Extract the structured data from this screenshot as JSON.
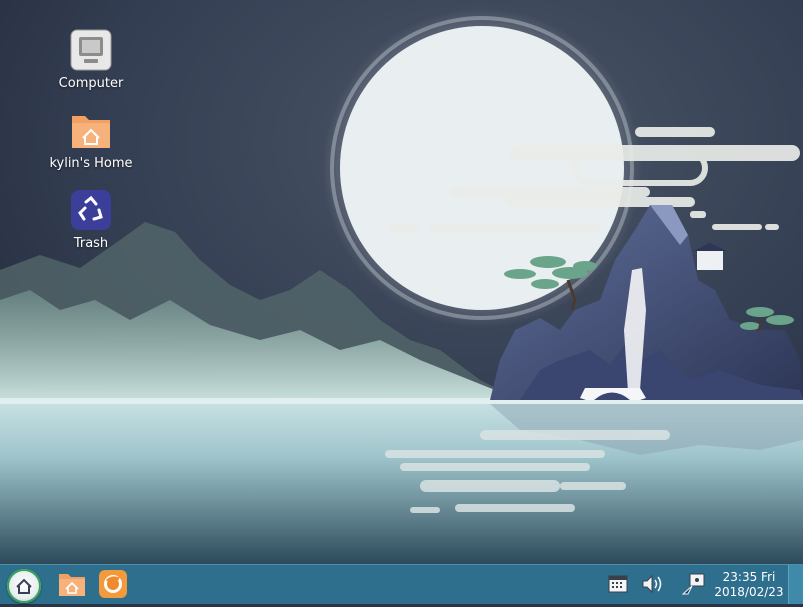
{
  "desktop": {
    "icons": [
      {
        "label": "Computer",
        "icon": "computer-icon"
      },
      {
        "label": "kylin's Home",
        "icon": "home-folder-icon"
      },
      {
        "label": "Trash",
        "icon": "trash-icon"
      }
    ]
  },
  "taskbar": {
    "start_menu_icon": "kylin-start-icon",
    "launchers": [
      {
        "icon": "file-manager-icon"
      },
      {
        "icon": "firefox-icon"
      }
    ],
    "tray": [
      {
        "icon": "calendar-icon"
      },
      {
        "icon": "volume-icon"
      },
      {
        "icon": "network-icon"
      }
    ],
    "clock": {
      "time": "23:35 Fri",
      "date": "2018/02/23"
    }
  },
  "colors": {
    "taskbar": "#2e6f8e",
    "sky": "#2b3447",
    "moon": "#e9eef0",
    "water": "#a9c9cf",
    "folder": "#f3a46a",
    "trash_bg": "#3b3f9a"
  }
}
